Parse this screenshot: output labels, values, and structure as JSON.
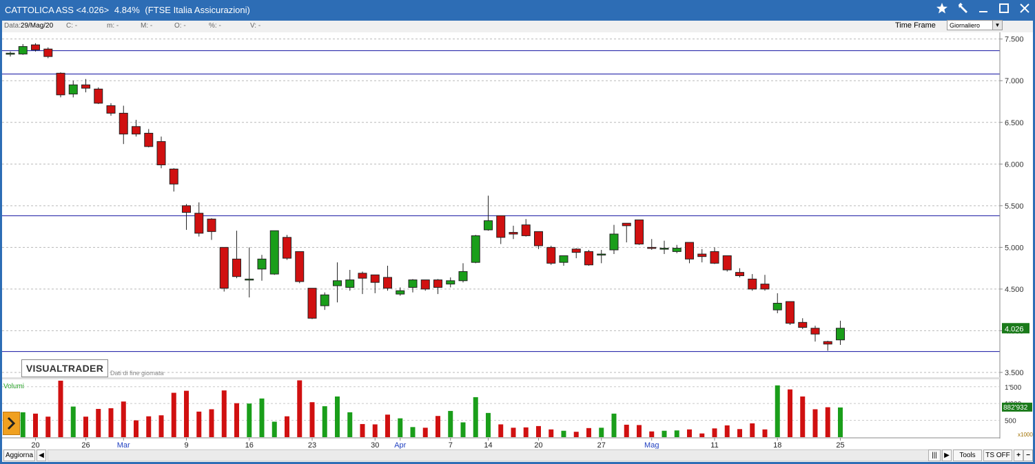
{
  "window": {
    "title": "CATTOLICA ASS <4.026>",
    "change": "4.84%",
    "index": "(FTSE Italia Assicurazioni)",
    "icons": [
      "star-icon",
      "tools-icon",
      "minimize-icon",
      "maximize-icon",
      "close-icon"
    ]
  },
  "infobar": {
    "data_label": "Data:",
    "data_value": "29/Mag/20",
    "c_label": "C:",
    "c_value": "-",
    "m_label": "m:",
    "m_value": "-",
    "M_label": "M:",
    "M_value": "-",
    "o_label": "O:",
    "o_value": "-",
    "pct_label": "%:",
    "pct_value": "-",
    "v_label": "V:",
    "v_value": "-",
    "timeframe_label": "Time Frame",
    "timeframe_value": "Giornaliero"
  },
  "branding": {
    "logo": "VISUALTRADER",
    "subtitle": "Dati di fine giornata"
  },
  "statusbar": {
    "refresh_label": "Aggiorna",
    "tools_label": "Tools",
    "ts_label": "TS OFF",
    "plus": "+",
    "minus": "−"
  },
  "colors": {
    "up": "#1a9e1a",
    "down": "#d01010",
    "hline": "#1010a0",
    "last_price_bg": "#1a7a1a",
    "month_label": "#2040c0"
  },
  "chart_data": {
    "type": "candlestick",
    "ylim": [
      3.45,
      7.58
    ],
    "y_ticks": [
      "7.500",
      "7.000",
      "6.500",
      "6.000",
      "5.500",
      "5.000",
      "4.500",
      "4.000",
      "3.500"
    ],
    "last_price_label": "4.026",
    "horizontal_lines": [
      7.36,
      7.08,
      5.38,
      3.75
    ],
    "x_labels": [
      {
        "i": 2,
        "text": "20",
        "month": false
      },
      {
        "i": 6,
        "text": "26",
        "month": false
      },
      {
        "i": 9,
        "text": "Mar",
        "month": true
      },
      {
        "i": 14,
        "text": "9",
        "month": false
      },
      {
        "i": 19,
        "text": "16",
        "month": false
      },
      {
        "i": 24,
        "text": "23",
        "month": false
      },
      {
        "i": 29,
        "text": "30",
        "month": false
      },
      {
        "i": 31,
        "text": "Apr",
        "month": true
      },
      {
        "i": 35,
        "text": "7",
        "month": false
      },
      {
        "i": 38,
        "text": "14",
        "month": false
      },
      {
        "i": 42,
        "text": "20",
        "month": false
      },
      {
        "i": 47,
        "text": "27",
        "month": false
      },
      {
        "i": 51,
        "text": "Mag",
        "month": true
      },
      {
        "i": 56,
        "text": "11",
        "month": false
      },
      {
        "i": 61,
        "text": "18",
        "month": false
      },
      {
        "i": 66,
        "text": "25",
        "month": false
      }
    ],
    "candles": [
      [
        7.32,
        7.33,
        7.35,
        7.29
      ],
      [
        7.32,
        7.41,
        7.44,
        7.31
      ],
      [
        7.43,
        7.37,
        7.45,
        7.35
      ],
      [
        7.38,
        7.29,
        7.4,
        7.27
      ],
      [
        7.09,
        6.83,
        7.1,
        6.8
      ],
      [
        6.84,
        6.95,
        7.0,
        6.8
      ],
      [
        6.95,
        6.91,
        7.02,
        6.86
      ],
      [
        6.9,
        6.73,
        6.92,
        6.72
      ],
      [
        6.7,
        6.61,
        6.73,
        6.58
      ],
      [
        6.61,
        6.36,
        6.7,
        6.24
      ],
      [
        6.45,
        6.36,
        6.53,
        6.33
      ],
      [
        6.37,
        6.21,
        6.42,
        6.2
      ],
      [
        6.27,
        5.99,
        6.33,
        5.95
      ],
      [
        5.94,
        5.76,
        5.95,
        5.67
      ],
      [
        5.5,
        5.42,
        5.52,
        5.21
      ],
      [
        5.41,
        5.17,
        5.54,
        5.13
      ],
      [
        5.34,
        5.19,
        5.35,
        5.09
      ],
      [
        5.0,
        4.51,
        5.0,
        4.47
      ],
      [
        4.86,
        4.65,
        5.2,
        4.63
      ],
      [
        4.62,
        4.62,
        5.0,
        4.4
      ],
      [
        4.74,
        4.86,
        4.91,
        4.6
      ],
      [
        4.68,
        5.2,
        5.2,
        4.67
      ],
      [
        5.12,
        4.87,
        5.15,
        4.85
      ],
      [
        4.95,
        4.59,
        4.95,
        4.57
      ],
      [
        4.51,
        4.15,
        4.51,
        4.14
      ],
      [
        4.3,
        4.43,
        4.46,
        4.25
      ],
      [
        4.54,
        4.6,
        4.82,
        4.34
      ],
      [
        4.52,
        4.61,
        4.73,
        4.48
      ],
      [
        4.69,
        4.63,
        4.71,
        4.44
      ],
      [
        4.67,
        4.58,
        4.67,
        4.45
      ],
      [
        4.64,
        4.51,
        4.78,
        4.48
      ],
      [
        4.44,
        4.48,
        4.52,
        4.42
      ],
      [
        4.52,
        4.61,
        4.62,
        4.46
      ],
      [
        4.61,
        4.5,
        4.61,
        4.48
      ],
      [
        4.61,
        4.52,
        4.62,
        4.44
      ],
      [
        4.56,
        4.6,
        4.64,
        4.52
      ],
      [
        4.6,
        4.71,
        4.81,
        4.58
      ],
      [
        4.82,
        5.14,
        5.15,
        4.81
      ],
      [
        5.21,
        5.32,
        5.62,
        5.2
      ],
      [
        5.38,
        5.12,
        5.38,
        5.04
      ],
      [
        5.18,
        5.16,
        5.26,
        5.1
      ],
      [
        5.27,
        5.14,
        5.34,
        5.13
      ],
      [
        5.19,
        5.02,
        5.19,
        4.98
      ],
      [
        5.0,
        4.81,
        5.02,
        4.79
      ],
      [
        4.82,
        4.9,
        4.9,
        4.78
      ],
      [
        4.98,
        4.94,
        4.99,
        4.87
      ],
      [
        4.95,
        4.79,
        4.97,
        4.78
      ],
      [
        4.92,
        4.92,
        4.97,
        4.81
      ],
      [
        4.97,
        5.16,
        5.27,
        4.92
      ],
      [
        5.29,
        5.26,
        5.29,
        5.06
      ],
      [
        5.33,
        5.04,
        5.33,
        5.03
      ],
      [
        5.0,
        4.99,
        5.1,
        4.97
      ],
      [
        4.99,
        4.99,
        5.08,
        4.92
      ],
      [
        4.95,
        4.99,
        5.03,
        4.93
      ],
      [
        5.06,
        4.86,
        5.06,
        4.81
      ],
      [
        4.92,
        4.89,
        4.98,
        4.82
      ],
      [
        4.95,
        4.81,
        5.0,
        4.8
      ],
      [
        4.9,
        4.73,
        4.9,
        4.71
      ],
      [
        4.7,
        4.66,
        4.75,
        4.64
      ],
      [
        4.62,
        4.5,
        4.68,
        4.48
      ],
      [
        4.56,
        4.5,
        4.67,
        4.48
      ],
      [
        4.25,
        4.33,
        4.45,
        4.21
      ],
      [
        4.35,
        4.09,
        4.35,
        4.07
      ],
      [
        4.1,
        4.04,
        4.15,
        4.02
      ],
      [
        4.03,
        3.96,
        4.06,
        3.87
      ],
      [
        3.87,
        3.84,
        3.88,
        3.76
      ],
      [
        3.89,
        4.03,
        4.12,
        3.83
      ]
    ],
    "volume": {
      "label": "Volumi",
      "unit": "x1000",
      "ylim": [
        0,
        1700
      ],
      "y_ticks": [
        "1'500",
        "1'000",
        "500"
      ],
      "last_label": "882'932",
      "values": [
        740,
        700,
        610,
        1680,
        910,
        610,
        840,
        860,
        1060,
        500,
        620,
        650,
        1320,
        1380,
        760,
        830,
        1390,
        1010,
        1000,
        1150,
        460,
        620,
        1690,
        1040,
        920,
        1210,
        740,
        390,
        380,
        670,
        560,
        300,
        280,
        630,
        780,
        440,
        1190,
        720,
        380,
        280,
        290,
        330,
        230,
        190,
        160,
        270,
        280,
        700,
        370,
        360,
        170,
        190,
        200,
        230,
        110,
        260,
        350,
        240,
        410,
        230,
        1540,
        1420,
        1210,
        830,
        890,
        883
      ]
    }
  }
}
